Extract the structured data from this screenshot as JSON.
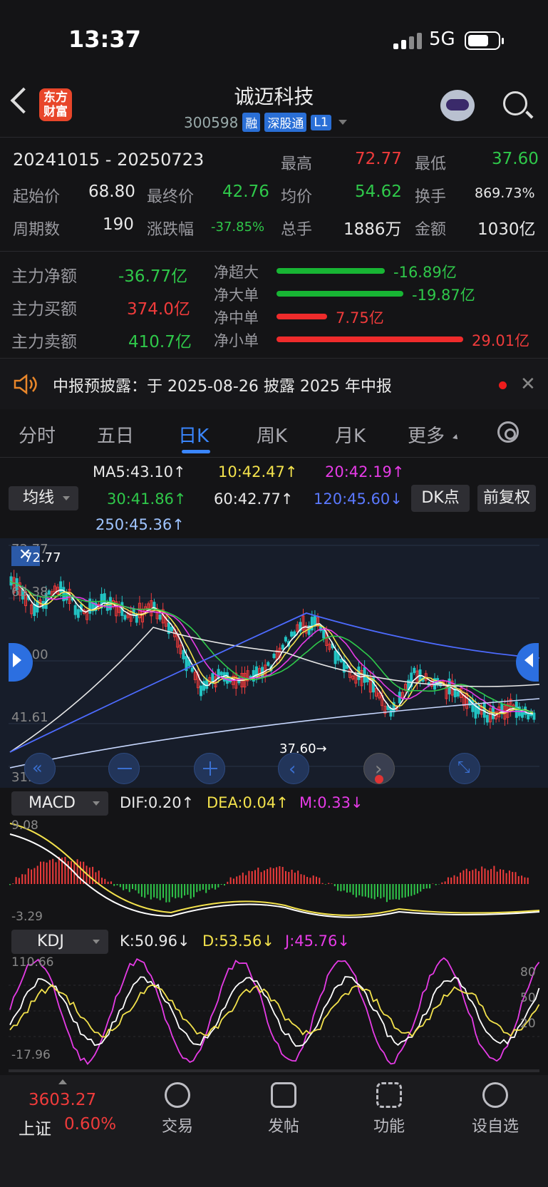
{
  "status": {
    "time": "13:37",
    "network": "5G"
  },
  "header": {
    "logo_text": "东方财富",
    "stock_name": "诚迈科技",
    "stock_code": "300598",
    "tags": [
      "融",
      "深股通",
      "L1"
    ]
  },
  "period": {
    "range": "20241015  -  20250723",
    "high_label": "最高",
    "high": "72.77",
    "low_label": "最低",
    "low": "37.60",
    "start_label": "起始价",
    "start": "68.80",
    "final_label": "最终价",
    "final": "42.76",
    "avg_label": "均价",
    "avg": "54.62",
    "turnover_label": "换手",
    "turnover": "869.73%",
    "count_label": "周期数",
    "count": "190",
    "change_label": "涨跌幅",
    "change": "-37.85%",
    "volume_label": "总手",
    "volume": "1886万",
    "amount_label": "金额",
    "amount": "1030亿"
  },
  "fund_flow": {
    "net_label": "主力净额",
    "net": "-36.77亿",
    "buy_label": "主力买额",
    "buy": "374.0亿",
    "sell_label": "主力卖额",
    "sell": "410.7亿",
    "items": [
      {
        "label": "净超大",
        "value": "-16.89亿",
        "pct": 0.58,
        "color": "#18b534"
      },
      {
        "label": "净大单",
        "value": "-19.87亿",
        "pct": 0.68,
        "color": "#18b534"
      },
      {
        "label": "净中单",
        "value": "7.75亿",
        "pct": 0.27,
        "color": "#ef2b2b"
      },
      {
        "label": "净小单",
        "value": "29.01亿",
        "pct": 1.0,
        "color": "#ef2b2b"
      }
    ]
  },
  "notice": {
    "text": "中报预披露：于 2025-08-26 披露 2025 年中报"
  },
  "tabs": [
    "分时",
    "五日",
    "日K",
    "周K",
    "月K",
    "更多"
  ],
  "active_tab": "日K",
  "ma": {
    "select": "均线",
    "ma5": "MA5:43.10↑",
    "ma10": "10:42.47↑",
    "ma20": "20:42.19↑",
    "ma30": "30:41.86↑",
    "ma60": "60:42.77↑",
    "ma120": "120:45.60↓",
    "ma250": "250:45.36↑",
    "dk_button": "DK点",
    "fq_button": "前复权"
  },
  "kchart": {
    "y_top": "72.77",
    "high_mark": "72.77",
    "y2": "63.38",
    "y3": "52.00",
    "y4": "41.61",
    "y_bottom": "31.23",
    "low_mark": "37.60→"
  },
  "macd": {
    "select": "MACD",
    "dif": "DIF:0.20↑",
    "dea": "DEA:0.04↑",
    "m": "M:0.33↓",
    "y_top": "9.08",
    "y_bottom": "-3.29"
  },
  "kdj": {
    "select": "KDJ",
    "k": "K:50.96↓",
    "d": "D:53.56↓",
    "j": "J:45.76↓",
    "y_top": "110.66",
    "y_bottom": "-17.96",
    "l80": "80",
    "l50": "50",
    "l20": "20"
  },
  "bottom": {
    "index_value": "3603.27",
    "index_name": "上证",
    "index_change": "0.60%",
    "items": [
      "交易",
      "发帖",
      "功能",
      "设自选"
    ]
  }
}
